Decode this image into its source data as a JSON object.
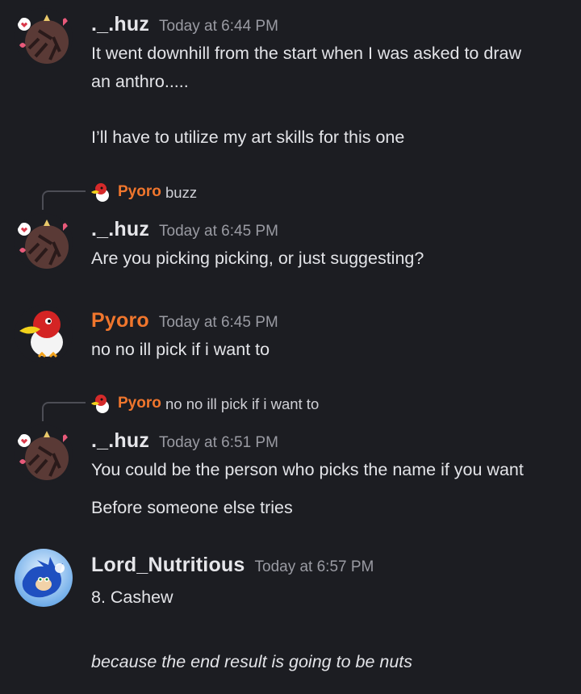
{
  "messages": [
    {
      "author": "._.huz",
      "time": "Today at 6:44 PM",
      "lines": [
        "It went downhill from the start when I was asked to draw",
        "an anthro.....",
        "I’ll have to utilize my art skills for this one"
      ]
    },
    {
      "reply": {
        "author": "Pyoro",
        "text": "buzz"
      },
      "author": "._.huz",
      "time": "Today at 6:45 PM",
      "lines": [
        "Are you picking picking, or just suggesting?"
      ]
    },
    {
      "author": "Pyoro",
      "time": "Today at 6:45 PM",
      "lines": [
        "no no ill pick if i want to"
      ]
    },
    {
      "reply": {
        "author": "Pyoro",
        "text": "no no ill pick if i want to"
      },
      "author": "._.huz",
      "time": "Today at 6:51 PM",
      "lines": [
        "You could be the person who picks the name if you want",
        "Before someone else tries"
      ]
    },
    {
      "author": "Lord_Nutritious",
      "time": "Today at 6:57 PM",
      "lines": [
        "8.  Cashew",
        "because the end result is going to be nuts"
      ]
    }
  ],
  "colors": {
    "background": "#1c1d22",
    "pyoro_name": "#f0762d",
    "text": "#e3e4e8",
    "timestamp": "#9a9ba3"
  }
}
